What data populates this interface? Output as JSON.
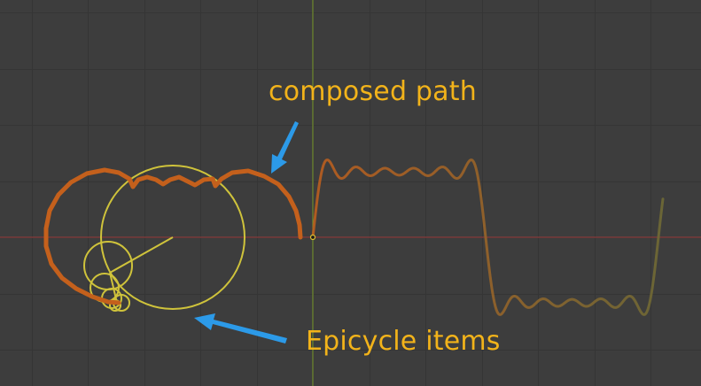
{
  "annotations": {
    "composed_path": "composed path",
    "epicycle_items": "Epicycle items"
  },
  "colors": {
    "background": "#3d3d3d",
    "grid": "#353535",
    "x_axis": "#9b3b3b",
    "y_axis": "#7c9c2c",
    "composed_path": "#c4601c",
    "wave": "#8a6a3a",
    "epicycle": "#cfc33b",
    "annotation_text": "#f2b31a",
    "arrow": "#2c9ae8"
  },
  "icons": {
    "arrow": "arrow-icon",
    "origin": "origin-point-icon"
  }
}
